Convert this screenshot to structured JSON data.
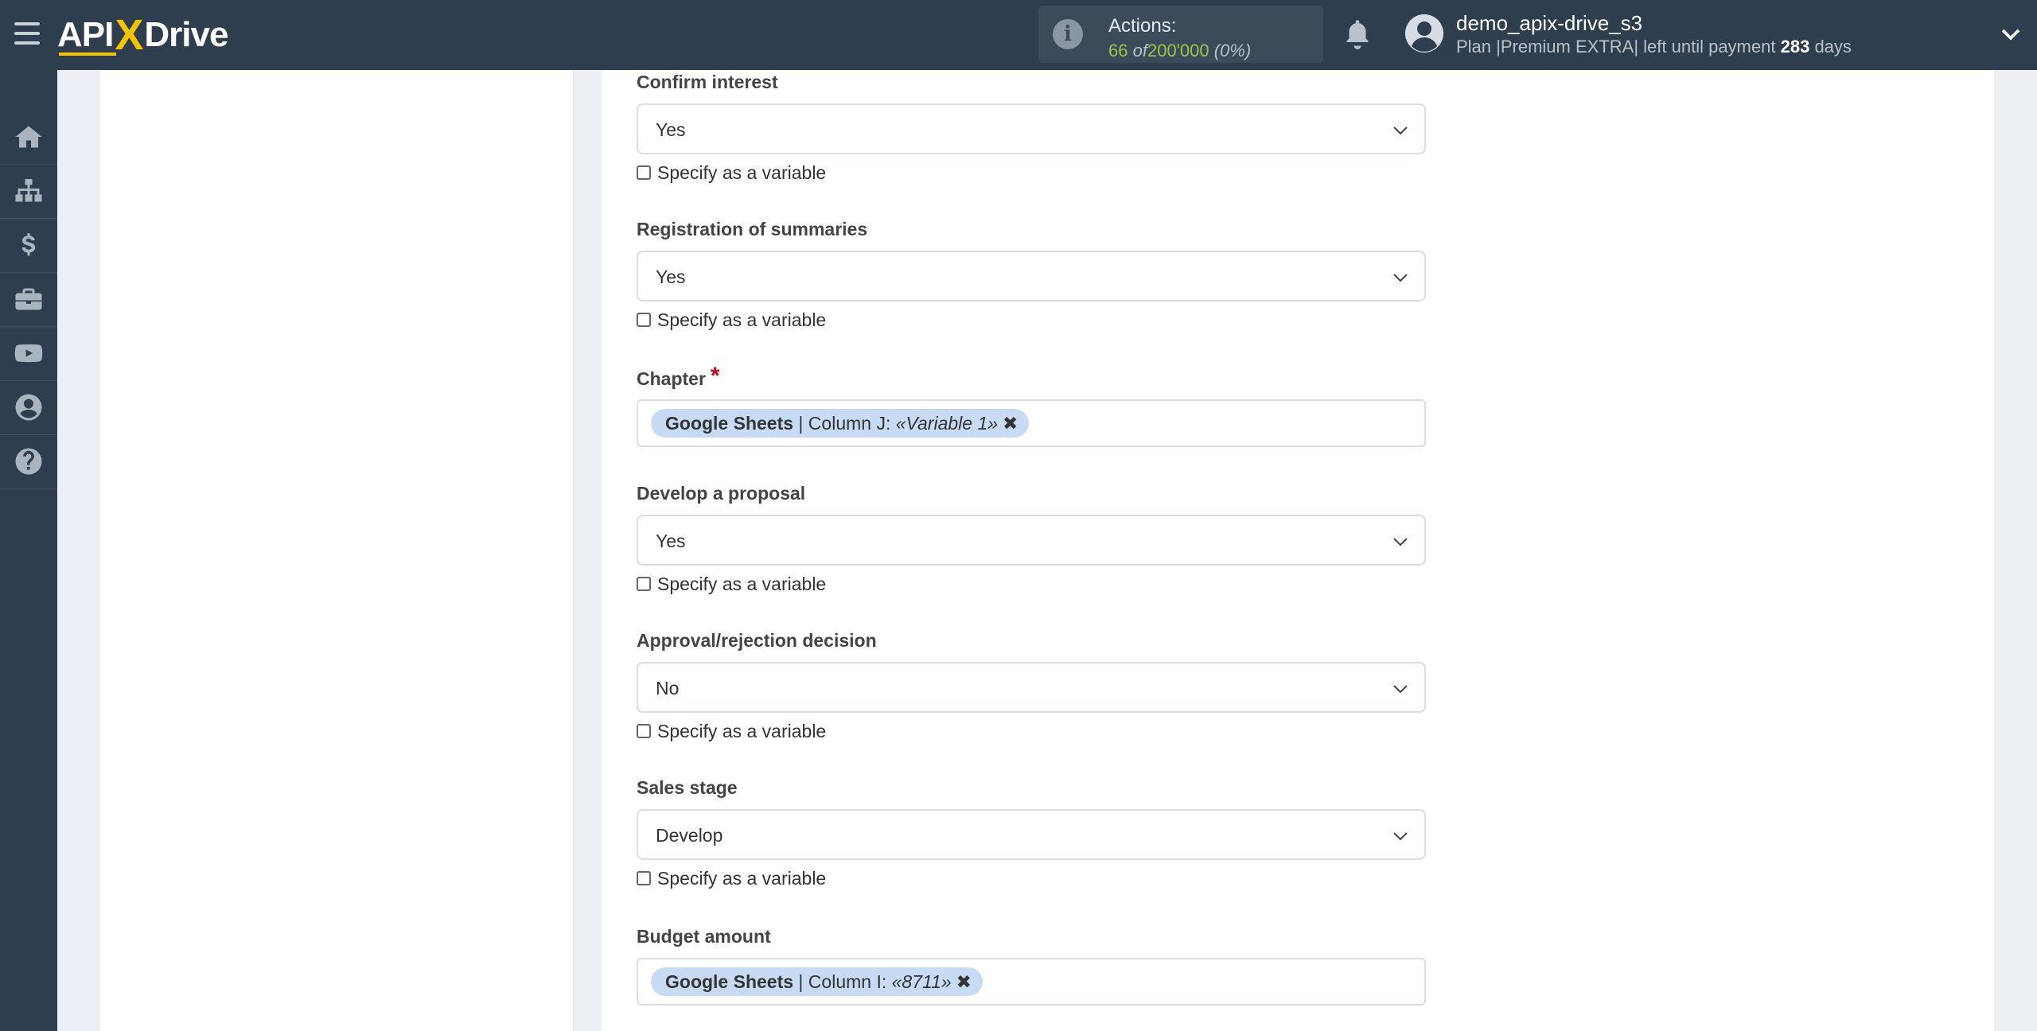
{
  "header": {
    "logo_api": "API",
    "logo_x": "X",
    "logo_drive": "Drive",
    "actions_label": "Actions:",
    "actions_used": "66",
    "actions_of": "of",
    "actions_total": "200'000",
    "actions_percent": "(0%)",
    "user_name": "demo_apix-drive_s3",
    "plan_prefix": "Plan |Premium EXTRA| left until payment",
    "plan_days": "283",
    "plan_suffix": "days"
  },
  "sidebar": {
    "items": [
      "home-icon",
      "sitemap-icon",
      "dollar-icon",
      "briefcase-icon",
      "youtube-icon",
      "user-circle-icon",
      "help-icon"
    ]
  },
  "colors": {
    "topbar": "#2e3e4e",
    "accent_yellow": "#f5c400",
    "actions_green": "#9cc34a",
    "required_red": "#d0021b",
    "tag_bg": "#c7dcf4"
  },
  "form": {
    "checkbox_label": "Specify as a variable",
    "fields": [
      {
        "label": "Confirm interest",
        "value": "Yes"
      },
      {
        "label": "Registration of summaries",
        "value": "Yes"
      },
      {
        "label": "Chapter",
        "required": "*",
        "tag_source": "Google Sheets",
        "tag_column": " | Column J: ",
        "tag_value": "«Variable 1»"
      },
      {
        "label": "Develop a proposal",
        "value": "Yes"
      },
      {
        "label": "Approval/rejection decision",
        "value": "No"
      },
      {
        "label": "Sales stage",
        "value": "Develop"
      },
      {
        "label": "Budget amount",
        "tag_source": "Google Sheets",
        "tag_column": " | Column I: ",
        "tag_value": "«8711»"
      }
    ]
  }
}
